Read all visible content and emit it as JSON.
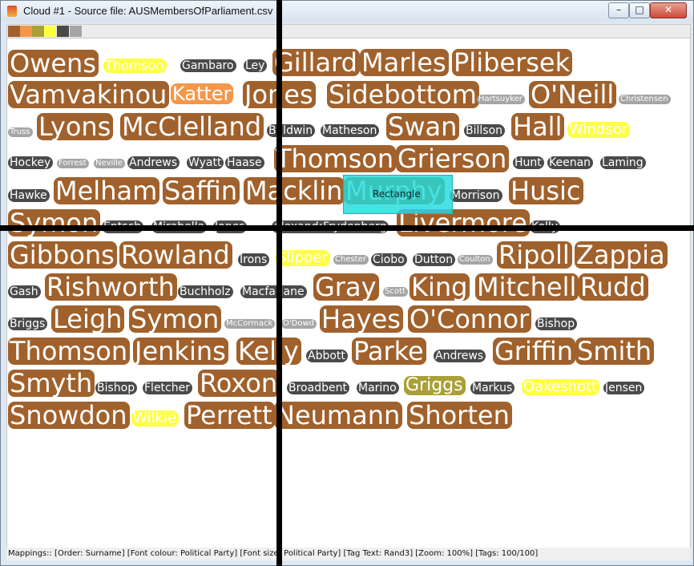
{
  "window": {
    "title": "Cloud #1 - Source file: AUSMembersOfParliament.csv",
    "minimize_glyph": "–",
    "maximize_glyph": "□",
    "close_glyph": "✕"
  },
  "palette": {
    "swatches": [
      {
        "color": "#a0612c"
      },
      {
        "color": "#f4974a"
      },
      {
        "color": "#aaa037"
      },
      {
        "color": "#ffff44"
      },
      {
        "color": "#4a4a4a"
      },
      {
        "color": "#a5a5a5"
      }
    ]
  },
  "tag_styles": {
    "brown": {
      "bg": "#a0612c",
      "fg": "#ffffff"
    },
    "orange": {
      "bg": "#f4974a",
      "fg": "#ffffff"
    },
    "olive": {
      "bg": "#aaa037",
      "fg": "#ffffff"
    },
    "yellow": {
      "bg": "#ffff44",
      "fg": "#ffffff"
    },
    "dark": {
      "bg": "#4a4a4a",
      "fg": "#ffffff"
    },
    "grey": {
      "bg": "#a5a5a5",
      "fg": "#ffffff"
    }
  },
  "tags": [
    {
      "text": "Owens",
      "style": "brown"
    },
    {
      "text": "Thomson",
      "style": "yellow"
    },
    {
      "text": "Gambaro",
      "style": "dark"
    },
    {
      "text": "Ley",
      "style": "dark"
    },
    {
      "text": "Gillard",
      "style": "brown"
    },
    {
      "text": "Marles",
      "style": "brown"
    },
    {
      "text": "Plibersek",
      "style": "brown"
    },
    {
      "text": "Vamvakinou",
      "style": "brown"
    },
    {
      "text": "Katter",
      "style": "orange"
    },
    {
      "text": "Jones",
      "style": "brown"
    },
    {
      "text": "Sidebottom",
      "style": "brown"
    },
    {
      "text": "Hartsuyker",
      "style": "grey"
    },
    {
      "text": "O'Neill",
      "style": "brown"
    },
    {
      "text": "Christensen",
      "style": "grey"
    },
    {
      "text": "Truss",
      "style": "grey"
    },
    {
      "text": "Lyons",
      "style": "brown"
    },
    {
      "text": "McClelland",
      "style": "brown"
    },
    {
      "text": "Baldwin",
      "style": "dark"
    },
    {
      "text": "Matheson",
      "style": "dark"
    },
    {
      "text": "Swan",
      "style": "brown"
    },
    {
      "text": "Billson",
      "style": "dark"
    },
    {
      "text": "Hall",
      "style": "brown"
    },
    {
      "text": "Windsor",
      "style": "yellow"
    },
    {
      "text": "Hockey",
      "style": "dark"
    },
    {
      "text": "Forrest",
      "style": "grey"
    },
    {
      "text": "Neville",
      "style": "grey"
    },
    {
      "text": "Andrews",
      "style": "dark"
    },
    {
      "text": "Wyatt",
      "style": "dark"
    },
    {
      "text": "Haase",
      "style": "dark"
    },
    {
      "text": "Thomson",
      "style": "brown"
    },
    {
      "text": "Grierson",
      "style": "brown"
    },
    {
      "text": "Hunt",
      "style": "dark"
    },
    {
      "text": "Keenan",
      "style": "dark"
    },
    {
      "text": "Laming",
      "style": "dark"
    },
    {
      "text": "Hawke",
      "style": "dark"
    },
    {
      "text": "Melham",
      "style": "brown"
    },
    {
      "text": "Saffin",
      "style": "brown"
    },
    {
      "text": "Macklin",
      "style": "brown"
    },
    {
      "text": "Murphy",
      "style": "brown"
    },
    {
      "text": "Morrison",
      "style": "dark"
    },
    {
      "text": "Husic",
      "style": "brown"
    },
    {
      "text": "Symon",
      "style": "brown"
    },
    {
      "text": "Entsch",
      "style": "dark"
    },
    {
      "text": "Mirabella",
      "style": "dark"
    },
    {
      "text": "Jones",
      "style": "dark"
    },
    {
      "text": "Alexander",
      "style": "dark"
    },
    {
      "text": "Frydenberg",
      "style": "dark"
    },
    {
      "text": "Livermore",
      "style": "brown"
    },
    {
      "text": "Kelly",
      "style": "dark"
    },
    {
      "text": "Gibbons",
      "style": "brown"
    },
    {
      "text": "Rowland",
      "style": "brown"
    },
    {
      "text": "Irons",
      "style": "dark"
    },
    {
      "text": "Slipper",
      "style": "yellow"
    },
    {
      "text": "Chester",
      "style": "grey"
    },
    {
      "text": "Ciobo",
      "style": "dark"
    },
    {
      "text": "Dutton",
      "style": "dark"
    },
    {
      "text": "Coulton",
      "style": "grey"
    },
    {
      "text": "Ripoll",
      "style": "brown"
    },
    {
      "text": "Zappia",
      "style": "brown"
    },
    {
      "text": "Gash",
      "style": "dark"
    },
    {
      "text": "Rishworth",
      "style": "brown"
    },
    {
      "text": "Buchholz",
      "style": "dark"
    },
    {
      "text": "Macfarlane",
      "style": "dark"
    },
    {
      "text": "Gray",
      "style": "brown"
    },
    {
      "text": "Scott",
      "style": "grey"
    },
    {
      "text": "King",
      "style": "brown"
    },
    {
      "text": "Mitchell",
      "style": "brown"
    },
    {
      "text": "Rudd",
      "style": "brown"
    },
    {
      "text": "Briggs",
      "style": "dark"
    },
    {
      "text": "Leigh",
      "style": "brown"
    },
    {
      "text": "Symon",
      "style": "brown"
    },
    {
      "text": "McCormack",
      "style": "grey"
    },
    {
      "text": "O'Dowd",
      "style": "grey"
    },
    {
      "text": "Hayes",
      "style": "brown"
    },
    {
      "text": "O'Connor",
      "style": "brown"
    },
    {
      "text": "Bishop",
      "style": "dark"
    },
    {
      "text": "Thomson",
      "style": "brown"
    },
    {
      "text": "Jenkins",
      "style": "brown"
    },
    {
      "text": "Kelly",
      "style": "brown"
    },
    {
      "text": "Abbott",
      "style": "dark"
    },
    {
      "text": "Parke",
      "style": "brown"
    },
    {
      "text": "Andrews",
      "style": "dark"
    },
    {
      "text": "Griffin",
      "style": "brown"
    },
    {
      "text": "Smith",
      "style": "brown"
    },
    {
      "text": "Smyth",
      "style": "brown"
    },
    {
      "text": "Bishop",
      "style": "dark"
    },
    {
      "text": "Fletcher",
      "style": "dark"
    },
    {
      "text": "Roxon",
      "style": "brown"
    },
    {
      "text": "Broadbent",
      "style": "dark"
    },
    {
      "text": "Marino",
      "style": "dark"
    },
    {
      "text": "Griggs",
      "style": "olive"
    },
    {
      "text": "Markus",
      "style": "dark"
    },
    {
      "text": "Oakeshott",
      "style": "yellow"
    },
    {
      "text": "Jensen",
      "style": "dark"
    },
    {
      "text": "Snowdon",
      "style": "brown"
    },
    {
      "text": "Wilkie",
      "style": "yellow"
    },
    {
      "text": "Perrett",
      "style": "brown"
    },
    {
      "text": "Neumann",
      "style": "brown"
    },
    {
      "text": "Shorten",
      "style": "brown"
    }
  ],
  "selection": {
    "label": "Rectangle"
  },
  "status": "Mappings:: [Order: Surname]  [Font colour: Political Party]  [Font size: Political Party]  [Tag Text: Rand3]  [Zoom: 100%]  [Tags: 100/100]"
}
